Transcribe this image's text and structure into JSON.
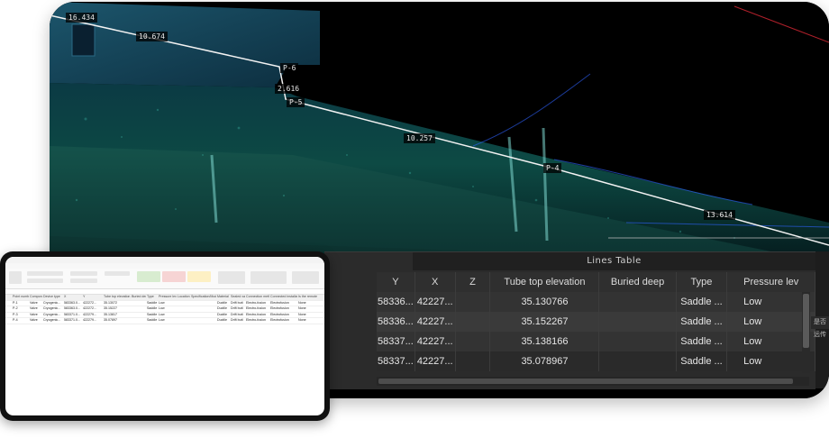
{
  "scene": {
    "measurements": [
      "16.434",
      "10.674",
      "P-6",
      "2.616",
      "P-5",
      "10.257",
      "P-4",
      "13.614"
    ]
  },
  "lines_table": {
    "title": "Lines Table",
    "columns": [
      "Y",
      "X",
      "Z",
      "Tube top elevation",
      "Buried deep",
      "Type",
      "Pressure lev"
    ],
    "rows": [
      [
        "58336...",
        "42227...",
        "",
        "35.130766",
        "",
        "Saddle ...",
        "Low"
      ],
      [
        "58336...",
        "42227...",
        "",
        "35.152267",
        "",
        "Saddle ...",
        "Low"
      ],
      [
        "58337...",
        "42227...",
        "",
        "35.138166",
        "",
        "Saddle ...",
        "Low"
      ],
      [
        "58337...",
        "42227...",
        "",
        "35.078967",
        "",
        "Saddle ...",
        "Low"
      ]
    ]
  },
  "side_panel": {
    "header": "是否远传"
  },
  "spreadsheet": {
    "header_cols": [
      "Point number",
      "Component Name",
      "Device type",
      "X",
      "Y",
      "Tube top elevation",
      "Buried deep",
      "Type",
      "Pressure level",
      "Location",
      "Specification/Model",
      "Material",
      "Sealed value",
      "Connection method",
      "Connected installation",
      "Is the remote"
    ],
    "rows": [
      [
        "P-1",
        "Valve",
        "Cryogenic...",
        "583363.0...",
        "422272...",
        "35.13072",
        "",
        "Saddle fix pipe",
        "Low",
        "",
        "",
        "Ductile",
        "Drift butt",
        "Electro-fusion",
        "Electrofusion",
        "None"
      ],
      [
        "P-2",
        "Valve",
        "Cryogenic...",
        "583363.0...",
        "422272...",
        "35.15227",
        "",
        "Saddle fix pipe",
        "Low",
        "",
        "",
        "Ductile",
        "Drift butt",
        "Electro-fusion",
        "Electrofusion",
        "None"
      ],
      [
        "P-3",
        "Valve",
        "Cryogenic...",
        "583371.0...",
        "422279...",
        "35.13817",
        "",
        "Saddle fix pipe",
        "Low",
        "",
        "",
        "Ductile",
        "Drift butt",
        "Electro-fusion",
        "Electrofusion",
        "None"
      ],
      [
        "P-4",
        "Valve",
        "Cryogenic...",
        "583371.0...",
        "422279...",
        "35.07897",
        "",
        "Saddle fix pipe",
        "Low",
        "",
        "",
        "Ductile",
        "Drift butt",
        "Electro-fusion",
        "Electrofusion",
        "None"
      ]
    ]
  }
}
